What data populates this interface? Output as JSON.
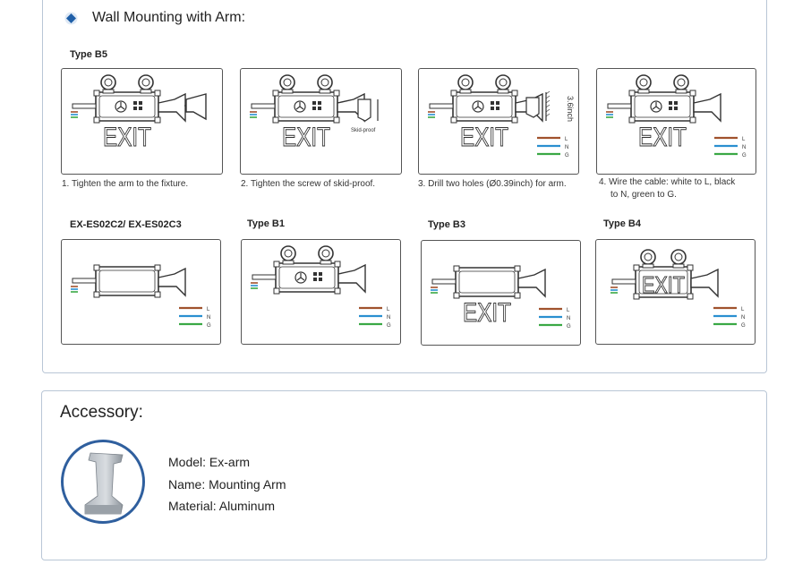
{
  "section": {
    "title": "Wall Mounting with Arm:",
    "accent": "#1f5fa8"
  },
  "steps": {
    "type_label": "Type B5",
    "captions": [
      "1. Tighten the arm to the fixture.",
      "2. Tighten the screw of skid-proof.",
      "3. Drill two holes (Ø0.39inch) for arm.",
      "4. Wire the cable: white to L, black",
      "to N, green to G."
    ],
    "skid_label": "Skid-proof",
    "dim_label": "3.6inch"
  },
  "models": [
    {
      "label": "EX-ES02C2/ EX-ES02C3"
    },
    {
      "label": "Type B1"
    },
    {
      "label": "Type B3"
    },
    {
      "label": "Type B4"
    }
  ],
  "diagram": {
    "exit_text": "EXIT",
    "wire_labels": [
      "L",
      "N",
      "G"
    ],
    "wire_colors": [
      "#a0522d",
      "#2a8fd0",
      "#3aa845"
    ]
  },
  "accessory": {
    "title": "Accessory:",
    "model": "Model: Ex-arm",
    "name": "Name: Mounting Arm",
    "material": "Material: Aluminum"
  }
}
